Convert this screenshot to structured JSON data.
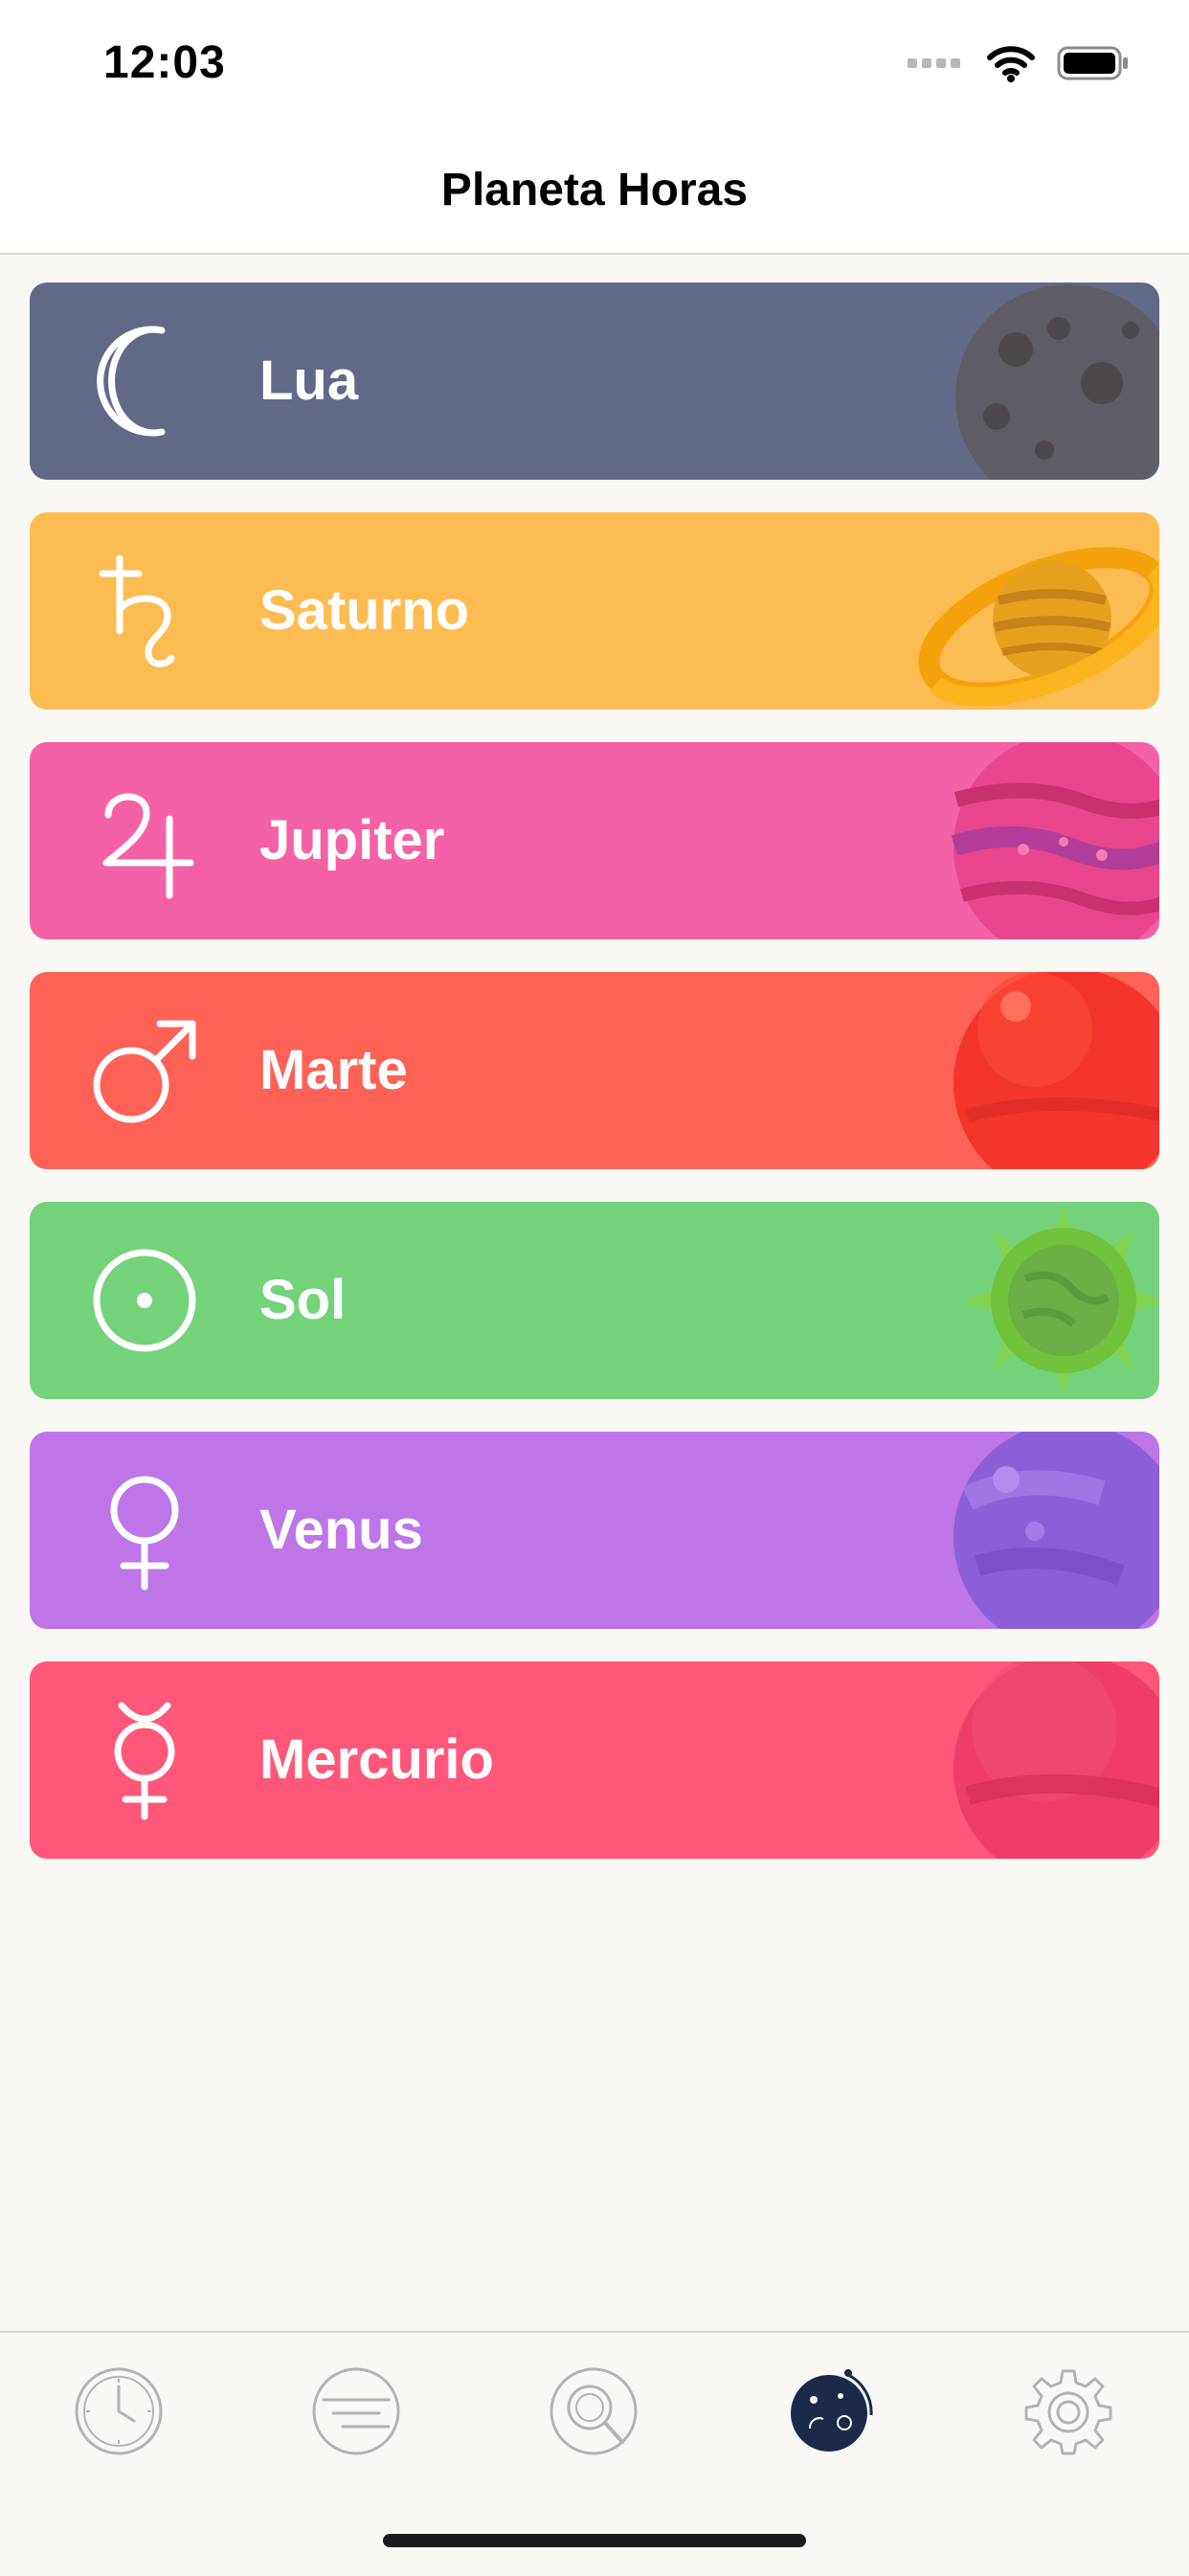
{
  "status_bar": {
    "time": "12:03"
  },
  "nav": {
    "title": "Planeta Horas"
  },
  "planets": [
    {
      "name": "Lua",
      "symbol": "moon-symbol-icon",
      "color": "#626987"
    },
    {
      "name": "Saturno",
      "symbol": "saturn-symbol-icon",
      "color": "#fdbc52"
    },
    {
      "name": "Jupiter",
      "symbol": "jupiter-symbol-icon",
      "color": "#f561a6"
    },
    {
      "name": "Marte",
      "symbol": "mars-symbol-icon",
      "color": "#fe6156"
    },
    {
      "name": "Sol",
      "symbol": "sun-symbol-icon",
      "color": "#74d27a"
    },
    {
      "name": "Venus",
      "symbol": "venus-symbol-icon",
      "color": "#be75e7"
    },
    {
      "name": "Mercurio",
      "symbol": "mercury-symbol-icon",
      "color": "#fe5779"
    }
  ],
  "tabs": [
    {
      "icon": "clock-icon",
      "active": false
    },
    {
      "icon": "list-icon",
      "active": false
    },
    {
      "icon": "search-icon",
      "active": false
    },
    {
      "icon": "planets-icon",
      "active": true
    },
    {
      "icon": "gear-icon",
      "active": false
    }
  ]
}
